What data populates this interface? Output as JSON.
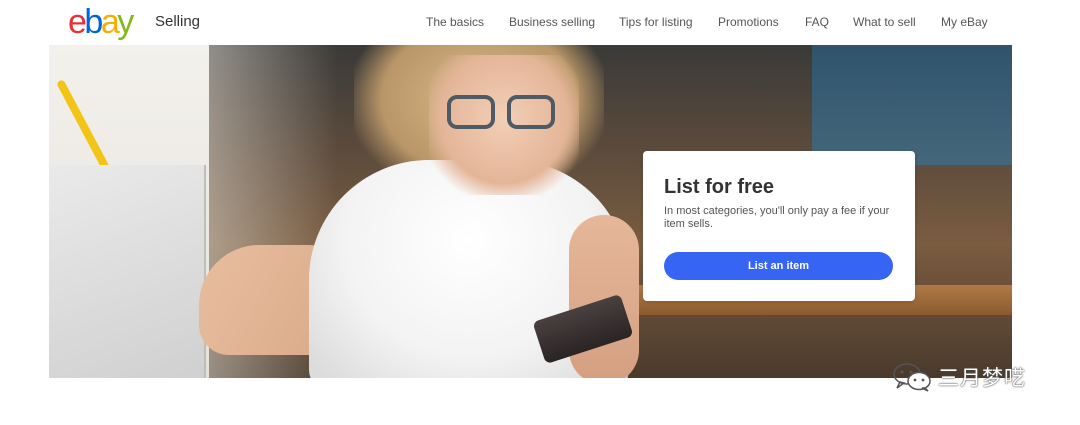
{
  "header": {
    "logo": {
      "letters": [
        "e",
        "b",
        "a",
        "y"
      ],
      "colors": [
        "#e53238",
        "#0064d2",
        "#f5af02",
        "#86b817"
      ]
    },
    "section": "Selling",
    "nav": [
      "The basics",
      "Business selling",
      "Tips for listing",
      "Promotions",
      "FAQ",
      "What to sell",
      "My eBay"
    ]
  },
  "hero": {
    "card": {
      "title": "List for free",
      "description": "In most categories, you'll only pay a fee if your item sells.",
      "button_label": "List an item",
      "button_color": "#3665f3"
    }
  },
  "watermark": {
    "icon": "wechat-icon",
    "text": "三月梦呓"
  }
}
